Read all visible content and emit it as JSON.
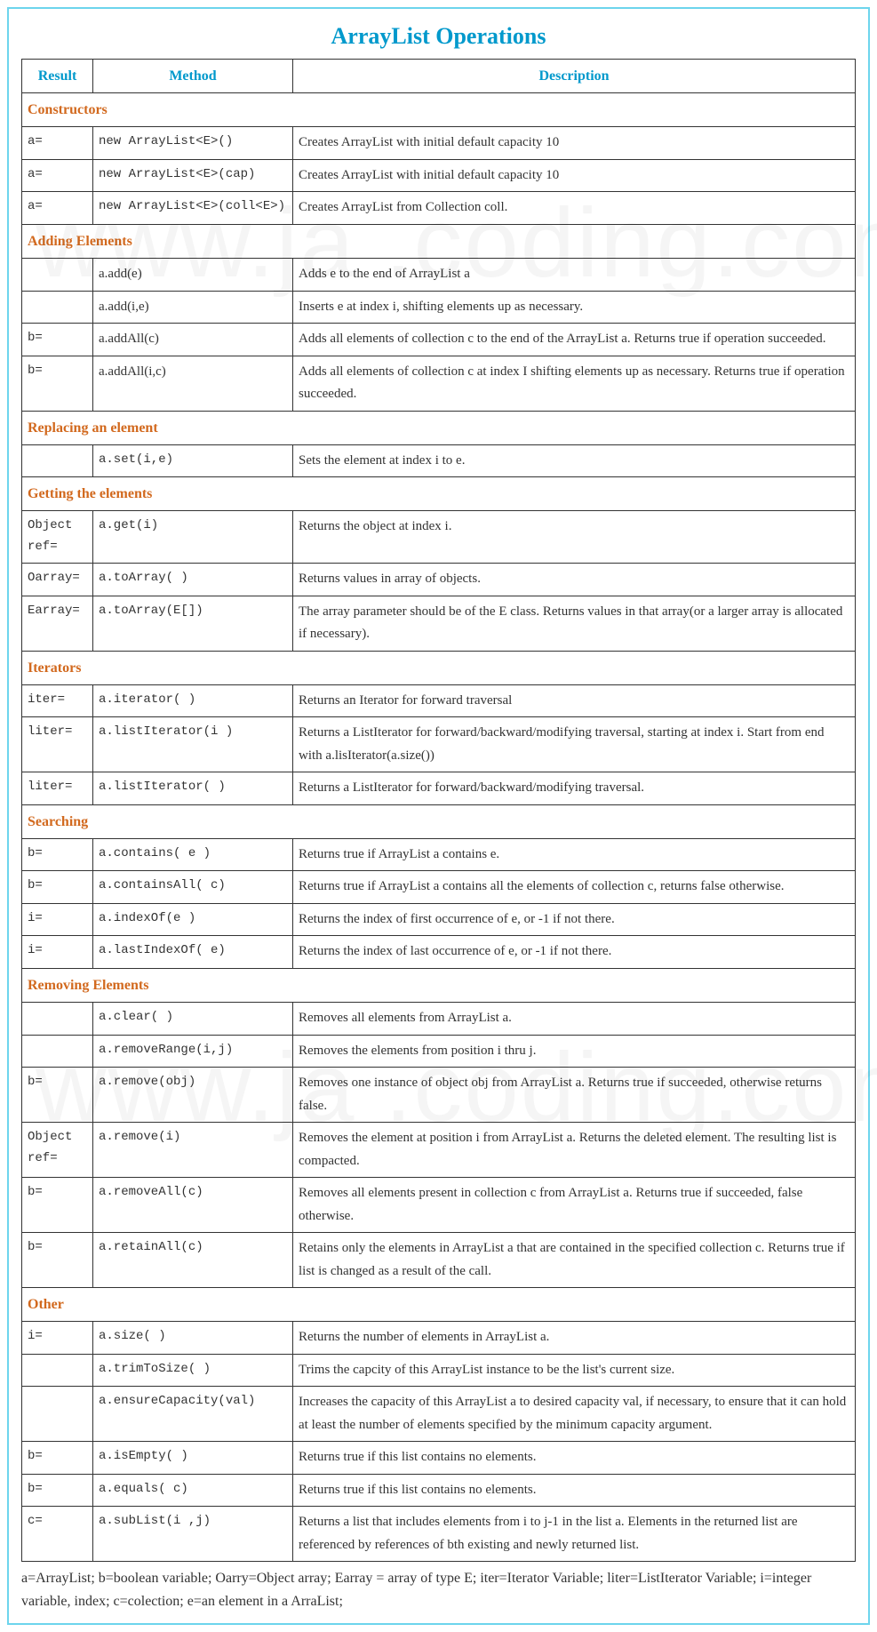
{
  "title": "ArrayList Operations",
  "watermark": "www.ja    .coding.com",
  "headers": {
    "result": "Result",
    "method": "Method",
    "description": "Description"
  },
  "sections": [
    {
      "name": "Constructors",
      "rows": [
        {
          "result": "a=",
          "method": "new ArrayList<E>()",
          "method_mono": true,
          "desc": "Creates ArrayList with initial default capacity 10"
        },
        {
          "result": "a=",
          "method": "new ArrayList<E>(cap)",
          "method_mono": true,
          "desc": "Creates ArrayList with initial default capacity 10"
        },
        {
          "result": "a=",
          "method": "new ArrayList<E>(coll<E>)",
          "method_mono": true,
          "desc": "Creates ArrayList from Collection coll."
        }
      ]
    },
    {
      "name": "Adding Elements",
      "rows": [
        {
          "result": "",
          "method": "a.add(e)",
          "method_mono": false,
          "desc": "Adds e to the end of ArrayList a"
        },
        {
          "result": "",
          "method": "a.add(i,e)",
          "method_mono": false,
          "desc": "Inserts e at index i, shifting elements up as necessary."
        },
        {
          "result": "b=",
          "method": "a.addAll(c)",
          "method_mono": false,
          "desc": "Adds all elements of collection c to the end of the ArrayList a. Returns true if operation succeeded."
        },
        {
          "result": "b=",
          "method": "a.addAll(i,c)",
          "method_mono": false,
          "desc": "Adds all elements of collection c at index I shifting elements up as necessary. Returns true if operation succeeded."
        }
      ]
    },
    {
      "name": "Replacing an element",
      "rows": [
        {
          "result": "",
          "method": "a.set(i,e)",
          "method_mono": true,
          "desc": "Sets the element at index i to e."
        }
      ]
    },
    {
      "name": "Getting the elements",
      "rows": [
        {
          "result": "Object ref=",
          "method": "a.get(i)",
          "method_mono": true,
          "desc": "Returns the object at index i."
        },
        {
          "result": "Oarray=",
          "method": "a.toArray(  )",
          "method_mono": true,
          "desc": "Returns values in array of objects."
        },
        {
          "result": "Earray=",
          "method": "a.toArray(E[])",
          "method_mono": true,
          "desc": "The array parameter should be of the E class. Returns values in that array(or a larger array is allocated if necessary)."
        }
      ]
    },
    {
      "name": "Iterators",
      "rows": [
        {
          "result": "iter=",
          "method": "a.iterator( )",
          "method_mono": true,
          "desc": "Returns an Iterator for forward traversal"
        },
        {
          "result": "liter=",
          "method": "a.listIterator(i )",
          "method_mono": true,
          "desc": "Returns a ListIterator for forward/backward/modifying traversal, starting at index i. Start from end with a.lisIterator(a.size())"
        },
        {
          "result": "liter=",
          "method": "a.listIterator( )",
          "method_mono": true,
          "desc": "Returns a ListIterator for forward/backward/modifying traversal."
        }
      ]
    },
    {
      "name": "Searching",
      "rows": [
        {
          "result": "b=",
          "method": "a.contains( e )",
          "method_mono": true,
          "desc": "Returns true if ArrayList a contains e."
        },
        {
          "result": "b=",
          "method": "a.containsAll( c)",
          "method_mono": true,
          "desc": "Returns true if ArrayList a contains all the elements of collection c, returns false otherwise."
        },
        {
          "result": "i=",
          "method": "a.indexOf(e )",
          "method_mono": true,
          "desc": "Returns the index of first occurrence of e, or -1 if not there."
        },
        {
          "result": "i=",
          "method": "a.lastIndexOf( e)",
          "method_mono": true,
          "desc": "Returns the index of last occurrence of e, or -1 if not there."
        }
      ]
    },
    {
      "name": "Removing Elements",
      "rows": [
        {
          "result": "",
          "method": "a.clear( )",
          "method_mono": true,
          "desc": "Removes all elements from ArrayList a."
        },
        {
          "result": "",
          "method": "a.removeRange(i,j)",
          "method_mono": true,
          "desc": "Removes the elements from position i thru j."
        },
        {
          "result": "b=",
          "method": "a.remove(obj)",
          "method_mono": true,
          "desc": "Removes one instance of object obj from ArrayList a. Returns true if succeeded, otherwise returns false."
        },
        {
          "result": "Object ref=",
          "method": "a.remove(i)",
          "method_mono": true,
          "desc": "Removes the element at position i from ArrayList a. Returns the deleted element. The resulting list is compacted."
        },
        {
          "result": "b=",
          "method": "a.removeAll(c)",
          "method_mono": true,
          "desc": "Removes all elements present in collection c from ArrayList a. Returns true if succeeded, false otherwise."
        },
        {
          "result": "b=",
          "method": "a.retainAll(c)",
          "method_mono": true,
          "desc": "Retains only the elements in ArrayList a that are contained in the specified collection c. Returns true if list is changed as a result of the call."
        }
      ]
    },
    {
      "name": "Other",
      "rows": [
        {
          "result": "i=",
          "method": "a.size( )",
          "method_mono": true,
          "desc": "Returns the number of elements in ArrayList a."
        },
        {
          "result": "",
          "method": "a.trimToSize( )",
          "method_mono": true,
          "desc": "Trims the capcity of this ArrayList instance to be the list's current size."
        },
        {
          "result": "",
          "method": "a.ensureCapacity(val)",
          "method_mono": true,
          "desc": "Increases the capacity of this ArrayList a to desired capacity val, if necessary, to ensure that it can hold at least the number of elements specified by the minimum capacity argument."
        },
        {
          "result": "b=",
          "method": "a.isEmpty( )",
          "method_mono": true,
          "desc": "Returns true if this list contains no elements."
        },
        {
          "result": "b=",
          "method": "a.equals( c)",
          "method_mono": true,
          "desc": "Returns true if this list contains no elements."
        },
        {
          "result": "c=",
          "method": "a.subList(i ,j)",
          "method_mono": true,
          "desc": "Returns a list that includes elements from i to j-1 in the list a. Elements in the returned list are referenced by references of bth existing and newly returned list."
        }
      ]
    }
  ],
  "footnote": "a=ArrayList; b=boolean variable; Oarry=Object array; Earray = array of type E; iter=Iterator Variable; liter=ListIterator Variable; i=integer variable, index; c=colection; e=an element in a ArraList;"
}
